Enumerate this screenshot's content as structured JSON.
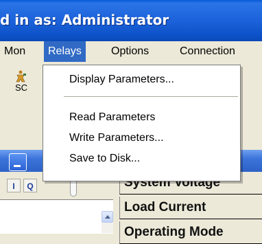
{
  "window": {
    "title": "d in as: Administrator"
  },
  "menubar": {
    "items": [
      {
        "label": "Mon",
        "active": false
      },
      {
        "label": "Relays",
        "active": true
      },
      {
        "label": "Options",
        "active": false
      },
      {
        "label": "Connection",
        "active": false
      }
    ]
  },
  "toolbar": {
    "sc_label": "SC",
    "sc_icon": "figure-icon"
  },
  "relays_menu": {
    "items": [
      {
        "label": "Display Parameters..."
      },
      {
        "label": "Read Parameters"
      },
      {
        "label": "Write Parameters..."
      },
      {
        "label": "Save to Disk..."
      }
    ]
  },
  "panel": {
    "small_buttons": [
      {
        "label": "I"
      },
      {
        "label": "Q"
      }
    ]
  },
  "parameter_rows": [
    {
      "label": "System Voltage"
    },
    {
      "label": "Load Current"
    },
    {
      "label": "Operating Mode"
    }
  ],
  "colors": {
    "titlebar": "#1c62da",
    "menu_highlight": "#316ac5",
    "panel_blue": "#3c74da"
  }
}
